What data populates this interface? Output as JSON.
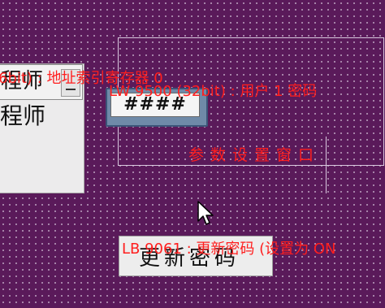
{
  "screen": {
    "background_color": "#5a1a5a",
    "label_color": "#ff1e1e"
  },
  "left_panel": {
    "combo_value": "程师",
    "list_items": [
      "程师"
    ]
  },
  "password_field": {
    "value": "####"
  },
  "labels": {
    "address_register": "6bit) : 地址索引寄存器 0",
    "user_password": "LW 9500 (32bit) : 用户 1 密码",
    "param_window": "参数设置窗口",
    "update_flag": "LB 9061 : 更新密码 (设置为 ON"
  },
  "buttons": {
    "update_password": "更新密码"
  },
  "icons": {
    "cursor": "mouse-pointer-icon",
    "dropdown": "dropdown-arrow-icon"
  }
}
